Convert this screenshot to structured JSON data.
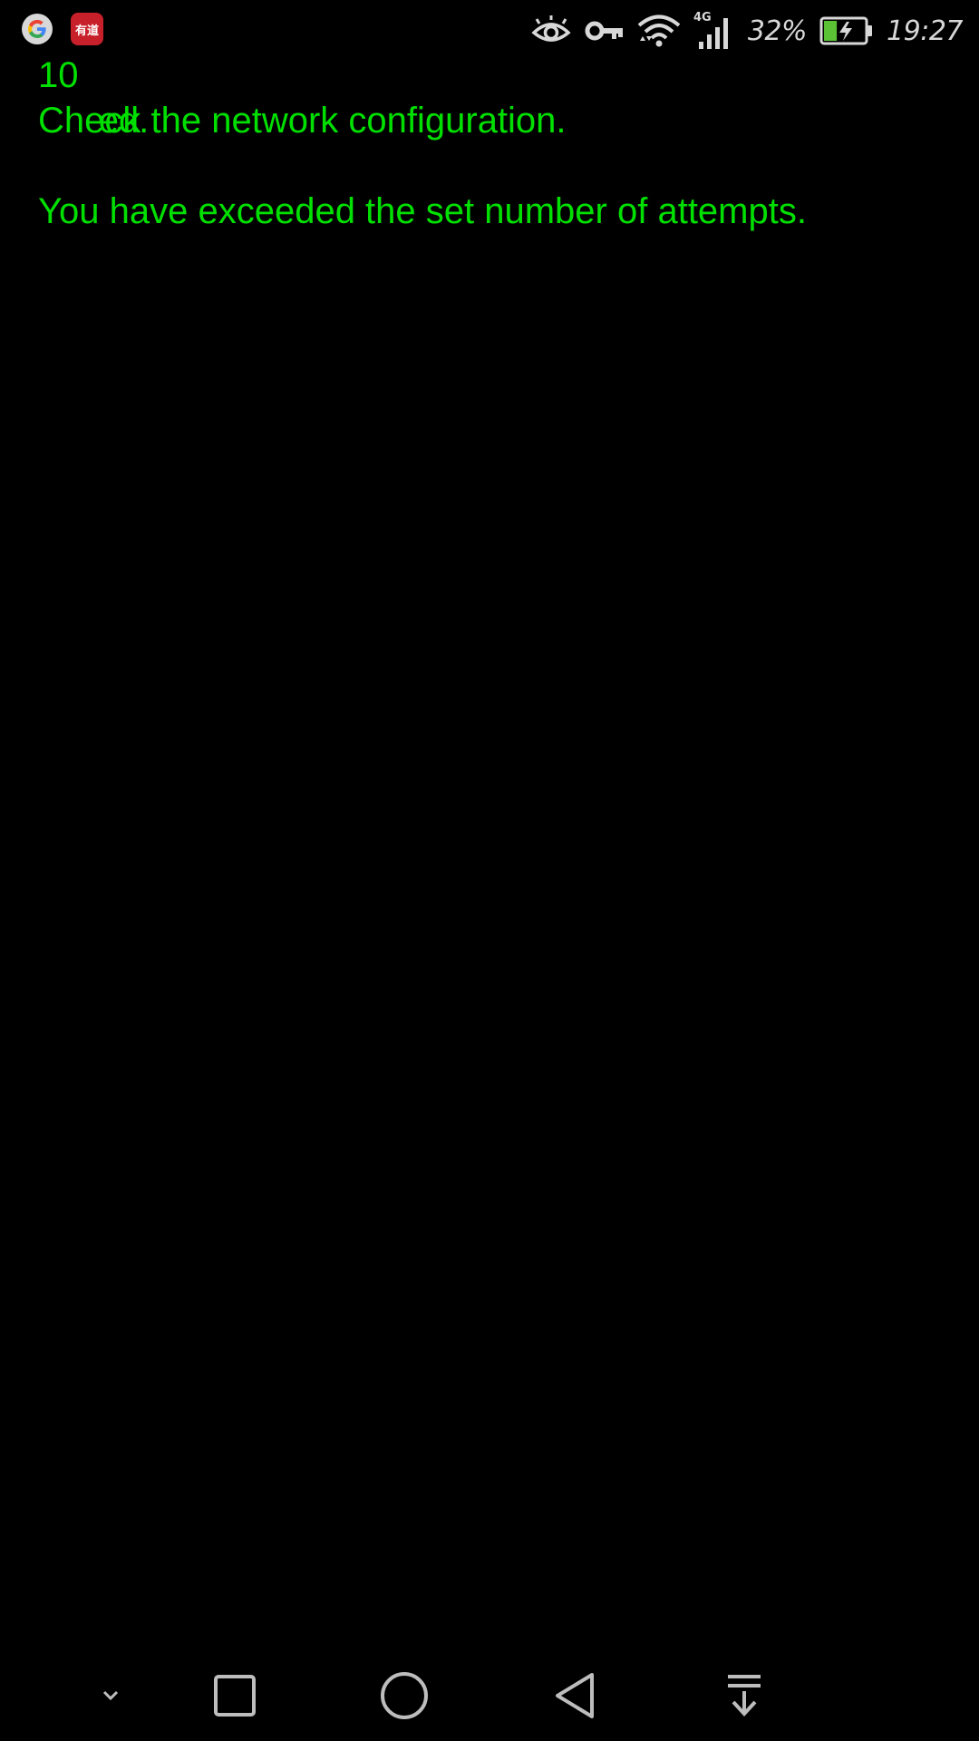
{
  "status_bar": {
    "notification_icons": [
      "google-icon",
      "youdao-dict-icon"
    ],
    "youdao_label": "有道",
    "system_icons": [
      "eye-comfort-icon",
      "vpn-key-icon",
      "wifi-icon",
      "signal-4g-icon"
    ],
    "network_type": "4G",
    "battery_percent": "32%",
    "battery_level": 0.32,
    "battery_charging": true,
    "time": "19:27"
  },
  "terminal": {
    "text_color": "#00e000",
    "lines": [
      "ed.",
      "Check the network configuration.",
      "",
      "You have exceeded the set number of attempts."
    ],
    "overlap_fragment": "10"
  },
  "nav_bar": {
    "buttons": [
      "hide-nav-icon",
      "recents-icon",
      "home-icon",
      "back-icon",
      "notifications-pull-icon"
    ]
  }
}
